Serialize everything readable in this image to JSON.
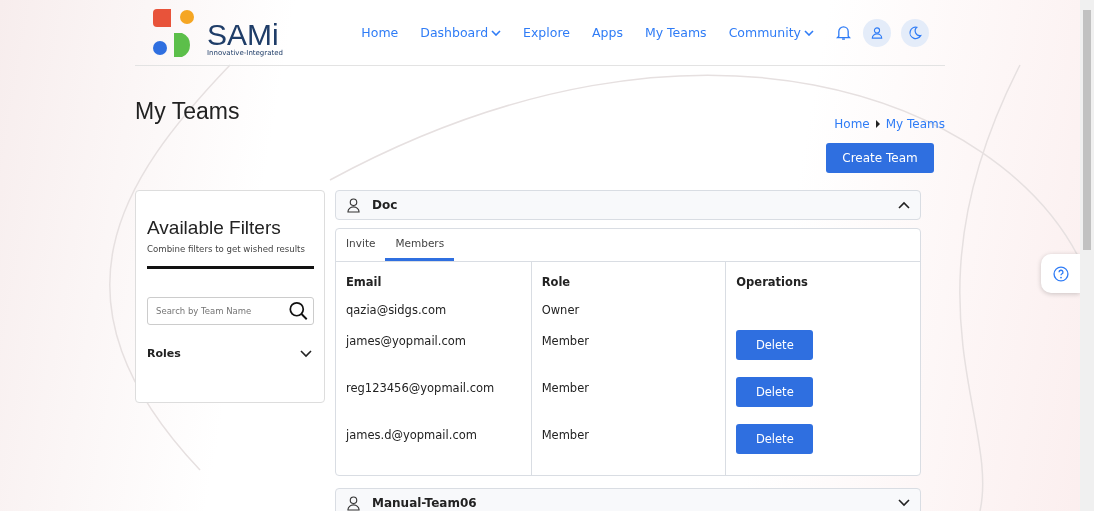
{
  "logo": {
    "name": "SAMi",
    "tagline": "Innovative-Integrated"
  },
  "nav": [
    {
      "label": "Home",
      "dropdown": false
    },
    {
      "label": "Dashboard",
      "dropdown": true
    },
    {
      "label": "Explore",
      "dropdown": false
    },
    {
      "label": "Apps",
      "dropdown": false
    },
    {
      "label": "My Teams",
      "dropdown": false
    },
    {
      "label": "Community",
      "dropdown": true
    }
  ],
  "page_title": "My Teams",
  "breadcrumb": [
    "Home",
    "My Teams"
  ],
  "create_button": "Create Team",
  "filters": {
    "title": "Available Filters",
    "subtitle": "Combine filters to get wished results",
    "search": {
      "placeholder": "Search by Team Name"
    },
    "sections": [
      {
        "label": "Roles",
        "expanded": false
      }
    ]
  },
  "teams": [
    {
      "name": "Doc",
      "expanded": true,
      "tabs": [
        {
          "label": "Invite",
          "selected": false
        },
        {
          "label": "Members",
          "selected": true
        }
      ],
      "columns": [
        "Email",
        "Role",
        "Operations"
      ],
      "rows": [
        {
          "email": "qazia@sidgs.com",
          "role": "Owner"
        },
        {
          "email": "james@yopmail.com",
          "role": "Member",
          "operation": "Delete"
        },
        {
          "email": "reg123456@yopmail.com",
          "role": "Member",
          "operation": "Delete"
        },
        {
          "email": "james.d@yopmail.com",
          "role": "Member",
          "operation": "Delete"
        }
      ]
    },
    {
      "name": "Manual-Team06",
      "expanded": false
    }
  ]
}
